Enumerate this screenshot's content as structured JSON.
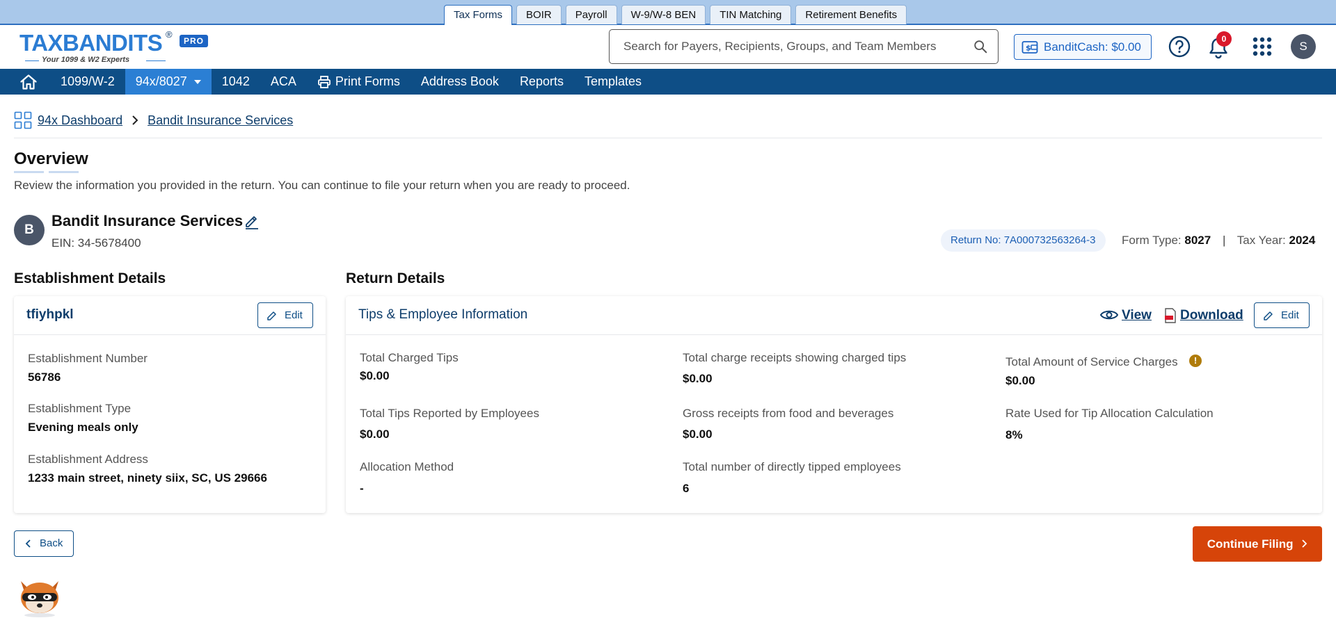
{
  "top_tabs": [
    {
      "label": "Tax Forms",
      "active": true
    },
    {
      "label": "BOIR"
    },
    {
      "label": "Payroll"
    },
    {
      "label": "W-9/W-8 BEN"
    },
    {
      "label": "TIN Matching"
    },
    {
      "label": "Retirement Benefits"
    }
  ],
  "logo": {
    "text": "TAXBANDITS",
    "tagline": "Your 1099 & W2 Experts",
    "badge": "PRO",
    "reg": "®"
  },
  "search": {
    "placeholder": "Search for Payers, Recipients, Groups, and Team Members"
  },
  "bandit_cash": {
    "label": "BanditCash: $0.00"
  },
  "notifications": {
    "count": "0"
  },
  "user": {
    "initial": "S"
  },
  "nav": [
    {
      "label": "1099/W-2"
    },
    {
      "label": "94x/8027",
      "active": true,
      "dropdown": true
    },
    {
      "label": "1042"
    },
    {
      "label": "ACA"
    },
    {
      "label": "Print Forms",
      "icon": "printer-icon"
    },
    {
      "label": "Address Book"
    },
    {
      "label": "Reports"
    },
    {
      "label": "Templates"
    }
  ],
  "breadcrumb": {
    "root": "94x Dashboard",
    "current": "Bandit Insurance Services"
  },
  "page": {
    "title": "Overview",
    "subtitle": "Review the information you provided in the return. You can continue to file your return when you are ready to proceed."
  },
  "payer": {
    "initial": "B",
    "name": "Bandit Insurance Services",
    "ein": "EIN: 34-5678400",
    "return_no": "Return No:  7A000732563264-3",
    "form_type_label": "Form Type:",
    "form_type": "8027",
    "tax_year_label": "Tax Year:",
    "tax_year": "2024",
    "separator": "|"
  },
  "establishment": {
    "section_title": "Establishment Details",
    "card_title": "tfiyhpkl",
    "edit_label": "Edit",
    "fields": [
      {
        "label": "Establishment Number",
        "value": "56786"
      },
      {
        "label": "Establishment Type",
        "value": "Evening meals only"
      },
      {
        "label": "Establishment Address",
        "value": "1233 main street, ninety siix, SC, US 29666"
      }
    ]
  },
  "return_details": {
    "section_title": "Return Details",
    "card_title": "Tips & Employee Information",
    "view_label": "View",
    "download_label": "Download",
    "edit_label": "Edit",
    "fields": [
      {
        "label": "Total Charged Tips",
        "value": "$0.00"
      },
      {
        "label": "Total charge receipts showing charged tips",
        "value": "$0.00"
      },
      {
        "label": "Total Amount of Service Charges",
        "value": "$0.00",
        "warning": "!"
      },
      {
        "label": "Total Tips Reported by Employees",
        "value": "$0.00"
      },
      {
        "label": "Gross receipts from food and beverages",
        "value": "$0.00"
      },
      {
        "label": "Rate Used for Tip Allocation Calculation",
        "value": "8%"
      },
      {
        "label": "Allocation Method",
        "value": "-"
      },
      {
        "label": "Total number of directly tipped employees",
        "value": "6"
      }
    ]
  },
  "actions": {
    "back_label": "Back",
    "continue_label": "Continue Filing"
  },
  "colors": {
    "nav": "#0e4e86",
    "nav_active": "#2b7fd4",
    "primary_text": "#0e3d6b",
    "continue": "#d64409",
    "badge": "#d9182b"
  }
}
